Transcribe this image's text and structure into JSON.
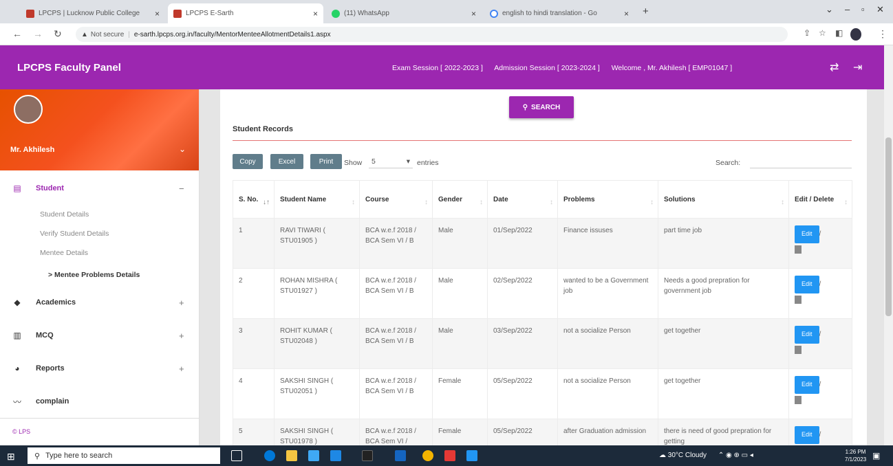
{
  "browser": {
    "tabs": [
      {
        "title": "LPCPS | Lucknow Public College",
        "active": false,
        "color": "#c0392b"
      },
      {
        "title": "LPCPS E-Sarth",
        "active": true,
        "color": "#c0392b"
      },
      {
        "title": "(11) WhatsApp",
        "active": false,
        "color": "#25d366"
      },
      {
        "title": "english to hindi translation - Go",
        "active": false,
        "color": "#4285f4"
      }
    ],
    "new_tab": "+",
    "security": "Not secure",
    "url": "e-sarth.lpcps.org.in/faculty/MentorMenteeAllotmentDetails1.aspx"
  },
  "header": {
    "brand": "LPCPS Faculty Panel",
    "exam_session": "Exam Session [ 2022-2023 ]",
    "admission_session": "Admission Session [ 2023-2024 ]",
    "welcome": "Welcome , Mr. Akhilesh [ EMP01047 ]",
    "accent": "#9c27b0"
  },
  "sidebar": {
    "user_name": "Mr. Akhilesh",
    "menu": [
      {
        "label": "Student",
        "toggle": "−",
        "icon": "clipboard-icon"
      },
      {
        "label": "Academics",
        "toggle": "+",
        "icon": "layers-icon"
      },
      {
        "label": "MCQ",
        "toggle": "+",
        "icon": "bar-chart-icon"
      },
      {
        "label": "Reports",
        "toggle": "+",
        "icon": "pie-chart-icon"
      },
      {
        "label": "complain",
        "toggle": "",
        "icon": "trend-icon"
      }
    ],
    "submenu": [
      "Student Details",
      "Verify Student Details",
      "Mentee Details",
      "> Mentee Problems Details"
    ],
    "footer": "© LPS"
  },
  "main": {
    "search_button": "SEARCH",
    "section_title": "Student Records",
    "buttons": {
      "copy": "Copy",
      "excel": "Excel",
      "print": "Print"
    },
    "show_label": "Show",
    "entries_value": "5",
    "entries_label": "entries",
    "search_label": "Search:",
    "columns": [
      "S. No.",
      "Student Name",
      "Course",
      "Gender",
      "Date",
      "Problems",
      "Solutions",
      "Edit / Delete"
    ],
    "rows": [
      {
        "sno": "1",
        "name": "RAVI TIWARI ( STU01905 )",
        "course": "BCA w.e.f 2018 / BCA Sem VI / B",
        "gender": "Male",
        "date": "01/Sep/2022",
        "problem": "Finance issuses",
        "solution": "part time job",
        "edit": "Edit"
      },
      {
        "sno": "2",
        "name": "ROHAN MISHRA ( STU01927 )",
        "course": "BCA w.e.f 2018 / BCA Sem VI / B",
        "gender": "Male",
        "date": "02/Sep/2022",
        "problem": "wanted to be a Government job",
        "solution": "Needs a good prepration for government job",
        "edit": "Edit"
      },
      {
        "sno": "3",
        "name": "ROHIT KUMAR ( STU02048 )",
        "course": "BCA w.e.f 2018 / BCA Sem VI / B",
        "gender": "Male",
        "date": "03/Sep/2022",
        "problem": "not a socialize Person",
        "solution": "get together",
        "edit": "Edit"
      },
      {
        "sno": "4",
        "name": "SAKSHI SINGH ( STU02051 )",
        "course": "BCA w.e.f 2018 / BCA Sem VI / B",
        "gender": "Female",
        "date": "05/Sep/2022",
        "problem": "not a socialize Person",
        "solution": "get together",
        "edit": "Edit"
      },
      {
        "sno": "5",
        "name": "SAKSHI SINGH ( STU01978 )",
        "course": "BCA w.e.f 2018 / BCA Sem VI /",
        "gender": "Female",
        "date": "05/Sep/2022",
        "problem": "after Graduation admission",
        "solution": "there is need of good prepration for getting",
        "edit": "Edit"
      }
    ]
  },
  "taskbar": {
    "search_placeholder": "Type here to search",
    "weather": "30°C  Cloudy",
    "time": "1:26 PM",
    "date": "7/1/2023"
  }
}
